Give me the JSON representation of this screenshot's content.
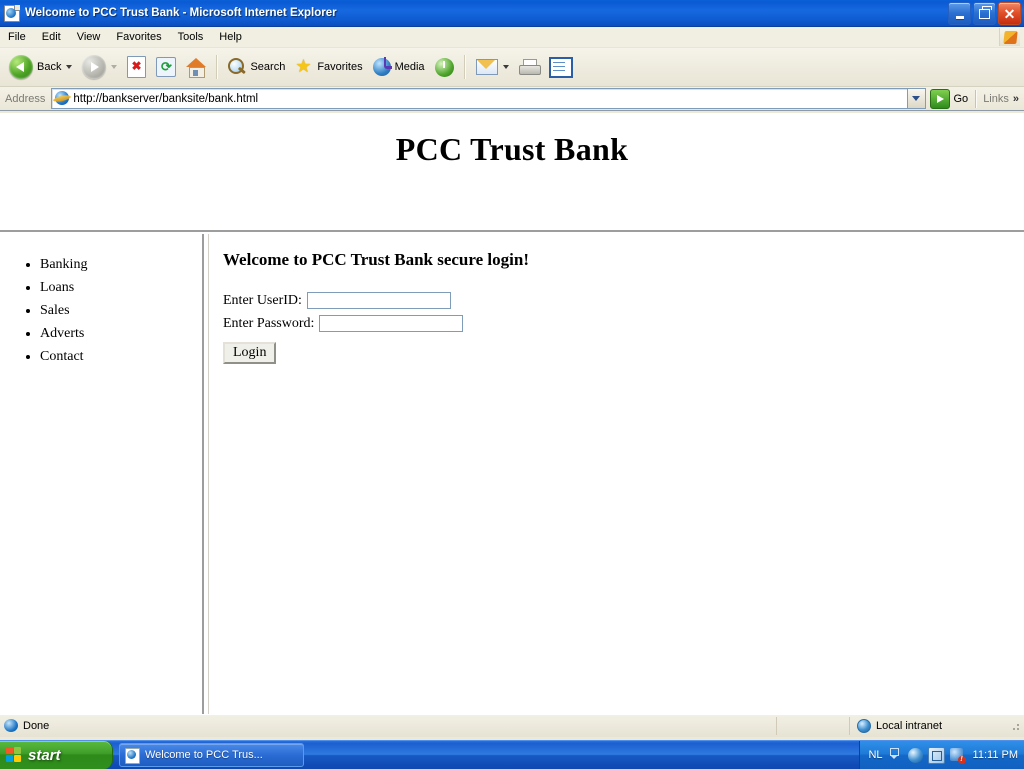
{
  "window": {
    "title": "Welcome to PCC Trust Bank - Microsoft Internet Explorer",
    "app_icon": "ie-document-icon",
    "minimize_label": "Minimize",
    "maximize_label": "Maximize",
    "close_label": "Close"
  },
  "menubar": {
    "items": [
      {
        "label": "File"
      },
      {
        "label": "Edit"
      },
      {
        "label": "View"
      },
      {
        "label": "Favorites"
      },
      {
        "label": "Tools"
      },
      {
        "label": "Help"
      }
    ],
    "brand_icon": "windows-flag-icon"
  },
  "toolbar": {
    "back": {
      "label": "Back",
      "icon": "back-arrow-icon",
      "enabled": true
    },
    "forward": {
      "label": "",
      "icon": "forward-arrow-icon",
      "enabled": false
    },
    "stop": {
      "label": "",
      "icon": "stop-icon"
    },
    "refresh": {
      "label": "",
      "icon": "refresh-icon"
    },
    "home": {
      "label": "",
      "icon": "home-icon"
    },
    "search": {
      "label": "Search",
      "icon": "search-icon"
    },
    "favorites": {
      "label": "Favorites",
      "icon": "star-icon"
    },
    "media": {
      "label": "Media",
      "icon": "media-icon"
    },
    "history": {
      "label": "",
      "icon": "history-icon"
    },
    "mail": {
      "label": "",
      "icon": "mail-icon"
    },
    "print": {
      "label": "",
      "icon": "print-icon"
    },
    "edit": {
      "label": "",
      "icon": "edit-page-icon"
    }
  },
  "address": {
    "label": "Address",
    "url": "http://bankserver/banksite/bank.html",
    "placeholder": "",
    "site_icon": "ie-favicon",
    "dropdown_icon": "chevron-down-icon",
    "go_label": "Go",
    "go_icon": "go-arrow-icon",
    "links_label": "Links",
    "links_chevron": "»"
  },
  "page": {
    "banner_title": "PCC Trust Bank",
    "nav": {
      "items": [
        {
          "label": "Banking"
        },
        {
          "label": "Loans"
        },
        {
          "label": "Sales"
        },
        {
          "label": "Adverts"
        },
        {
          "label": "Contact"
        }
      ]
    },
    "main": {
      "heading": "Welcome to PCC Trust Bank secure login!",
      "userid_label": "Enter UserID:",
      "userid_value": "",
      "password_label": "Enter Password:",
      "password_value": "",
      "login_button": "Login"
    }
  },
  "statusbar": {
    "status_text": "Done",
    "status_icon": "ie-document-icon",
    "zone_text": "Local intranet",
    "zone_icon": "globe-icon"
  },
  "taskbar": {
    "start_label": "start",
    "start_icon": "windows-flag-icon",
    "items": [
      {
        "label": "Welcome to PCC Trus...",
        "icon": "ie-document-icon"
      }
    ],
    "tray": {
      "language": "NL",
      "language_icon": "keyboard-layout-icon",
      "icons": [
        "media-player-icon",
        "network-icon",
        "security-alert-icon"
      ],
      "clock": "11:11 PM"
    }
  },
  "colors": {
    "titlebar_blue": "#0a5ad4",
    "toolbar_cream": "#efece0",
    "taskbar_blue": "#1c5fd0",
    "start_green": "#3f9e28",
    "close_red": "#e2512a",
    "frame_border": "#9d9d9d",
    "input_border": "#7f9db9"
  }
}
